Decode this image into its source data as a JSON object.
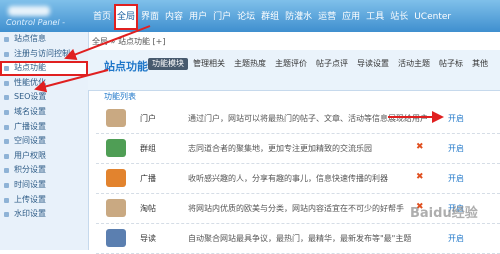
{
  "logo": {
    "subtitle": "Control Panel - "
  },
  "nav": [
    "首页",
    "全局",
    "界面",
    "内容",
    "用户",
    "门户",
    "论坛",
    "群组",
    "防灌水",
    "运营",
    "应用",
    "工具",
    "站长",
    "UCenter"
  ],
  "nav_active_index": 1,
  "sidebar": [
    "站点信息",
    "注册与访问控制",
    "站点功能",
    "性能优化",
    "SEO设置",
    "域名设置",
    "广播设置",
    "空间设置",
    "用户权限",
    "积分设置",
    "时间设置",
    "上传设置",
    "水印设置"
  ],
  "sidebar_selected_index": 2,
  "breadcrumb": "全局 » 站点功能 [+]",
  "page_title": "站点功能",
  "tabs": [
    "功能模块",
    "管理相关",
    "主题热度",
    "主题评价",
    "帖子点评",
    "导读设置",
    "活动主题",
    "帖子标",
    "其他"
  ],
  "tab_active_index": 0,
  "list_title": "功能列表",
  "rows": [
    {
      "icon": "portal-icon",
      "color": "#c9a982",
      "name": "门户",
      "desc": "通过门户，网站可以将最热门的帖子、文章、活动等信息展现给用户",
      "status": "",
      "action": "开启"
    },
    {
      "icon": "group-icon",
      "color": "#4f9e55",
      "name": "群组",
      "desc": "志同道合者的聚集地，更加专注更加精致的交流乐园",
      "status": "✖",
      "action": "开启"
    },
    {
      "icon": "broadcast-icon",
      "color": "#e2832e",
      "name": "广播",
      "desc": "收听感兴趣的人，分享有趣的事儿，信息快速传播的利器",
      "status": "✖",
      "action": "开启"
    },
    {
      "icon": "collection-icon",
      "color": "#c9a982",
      "name": "淘帖",
      "desc": "将网站内优质的欧美与分类，网站内容适宜在不可少的好帮手",
      "status": "✖",
      "action": "开启"
    },
    {
      "icon": "guide-icon",
      "color": "#5b7fb0",
      "name": "导读",
      "desc": "自动聚合网站最具争议，最热门，最精华，最新发布等\"最\"主题",
      "status": "",
      "action": "开启"
    }
  ],
  "watermark": "Baidu经验"
}
